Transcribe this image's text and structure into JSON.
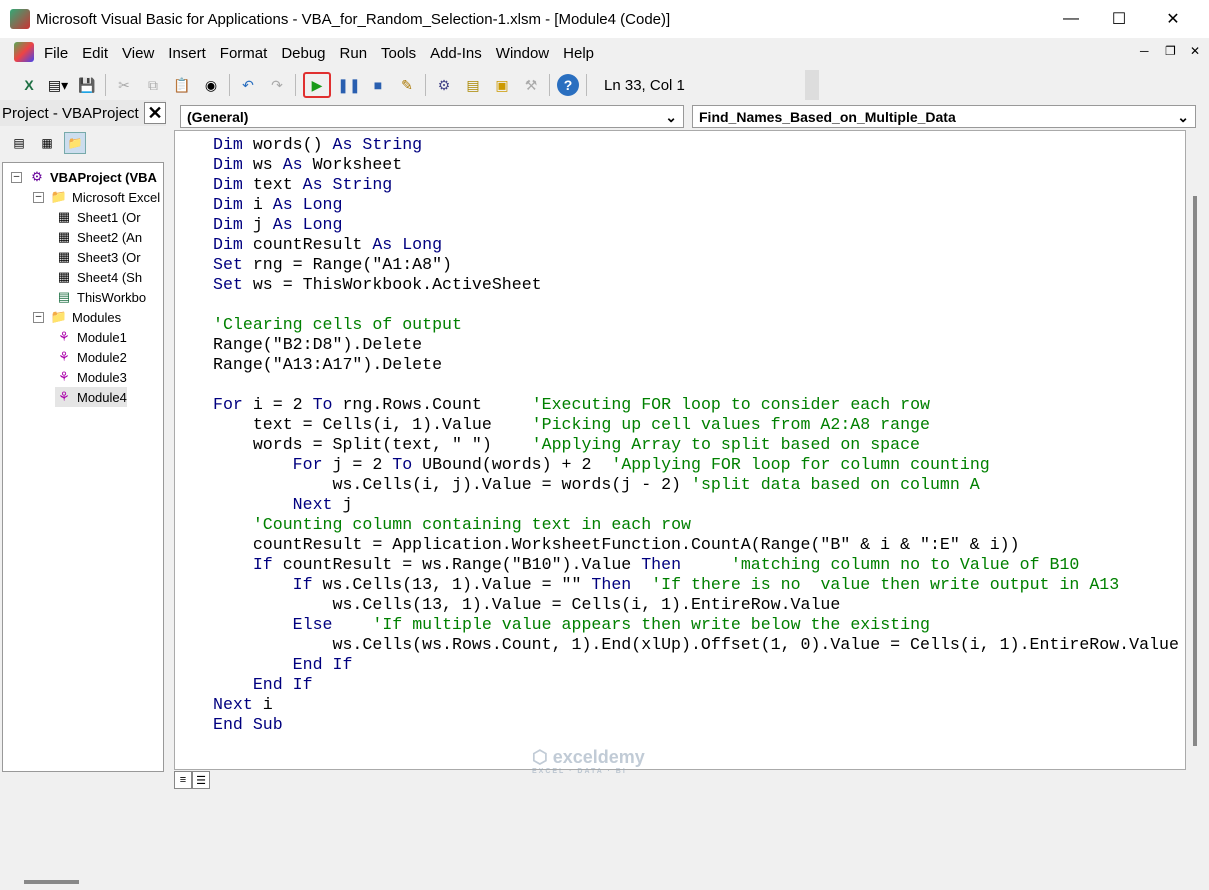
{
  "window": {
    "title": "Microsoft Visual Basic for Applications - VBA_for_Random_Selection-1.xlsm - [Module4 (Code)]"
  },
  "menu": [
    "File",
    "Edit",
    "View",
    "Insert",
    "Format",
    "Debug",
    "Run",
    "Tools",
    "Add-Ins",
    "Window",
    "Help"
  ],
  "toolbar": {
    "status": "Ln 33, Col 1",
    "icons": [
      "excel-icon",
      "insert-userform-icon",
      "save-icon",
      "cut-icon",
      "copy-icon",
      "paste-icon",
      "find-icon",
      "undo-icon",
      "redo-icon",
      "run-icon",
      "break-icon",
      "reset-icon",
      "design-mode-icon",
      "project-explorer-icon",
      "properties-icon",
      "object-browser-icon",
      "toolbox-icon",
      "help-icon"
    ]
  },
  "project": {
    "title": "Project - VBAProject",
    "tree": [
      {
        "label": "VBAProject (VBA",
        "level": 0,
        "type": "project",
        "bold": true
      },
      {
        "label": "Microsoft Excel",
        "level": 1,
        "type": "folder"
      },
      {
        "label": "Sheet1 (Or",
        "level": 2,
        "type": "sheet"
      },
      {
        "label": "Sheet2 (An",
        "level": 2,
        "type": "sheet"
      },
      {
        "label": "Sheet3 (Or",
        "level": 2,
        "type": "sheet"
      },
      {
        "label": "Sheet4 (Sh",
        "level": 2,
        "type": "sheet"
      },
      {
        "label": "ThisWorkbo",
        "level": 2,
        "type": "workbook"
      },
      {
        "label": "Modules",
        "level": 1,
        "type": "folder"
      },
      {
        "label": "Module1",
        "level": 2,
        "type": "module"
      },
      {
        "label": "Module2",
        "level": 2,
        "type": "module"
      },
      {
        "label": "Module3",
        "level": 2,
        "type": "module"
      },
      {
        "label": "Module4",
        "level": 2,
        "type": "module",
        "selected": true
      }
    ]
  },
  "code": {
    "object": "(General)",
    "procedure": "Find_Names_Based_on_Multiple_Data",
    "lines": [
      [
        [
          "k",
          "Dim"
        ],
        [
          "n",
          " words() "
        ],
        [
          "k",
          "As"
        ],
        [
          "n",
          " "
        ],
        [
          "k",
          "String"
        ]
      ],
      [
        [
          "k",
          "Dim"
        ],
        [
          "n",
          " ws "
        ],
        [
          "k",
          "As"
        ],
        [
          "n",
          " Worksheet"
        ]
      ],
      [
        [
          "k",
          "Dim"
        ],
        [
          "n",
          " text "
        ],
        [
          "k",
          "As"
        ],
        [
          "n",
          " "
        ],
        [
          "k",
          "String"
        ]
      ],
      [
        [
          "k",
          "Dim"
        ],
        [
          "n",
          " i "
        ],
        [
          "k",
          "As"
        ],
        [
          "n",
          " "
        ],
        [
          "k",
          "Long"
        ]
      ],
      [
        [
          "k",
          "Dim"
        ],
        [
          "n",
          " j "
        ],
        [
          "k",
          "As"
        ],
        [
          "n",
          " "
        ],
        [
          "k",
          "Long"
        ]
      ],
      [
        [
          "k",
          "Dim"
        ],
        [
          "n",
          " countResult "
        ],
        [
          "k",
          "As"
        ],
        [
          "n",
          " "
        ],
        [
          "k",
          "Long"
        ]
      ],
      [
        [
          "k",
          "Set"
        ],
        [
          "n",
          " rng = Range(\"A1:A8\")"
        ]
      ],
      [
        [
          "k",
          "Set"
        ],
        [
          "n",
          " ws = ThisWorkbook.ActiveSheet"
        ]
      ],
      [
        [
          "n",
          ""
        ]
      ],
      [
        [
          "c",
          "'Clearing cells of output"
        ]
      ],
      [
        [
          "n",
          "Range(\"B2:D8\").Delete"
        ]
      ],
      [
        [
          "n",
          "Range(\"A13:A17\").Delete"
        ]
      ],
      [
        [
          "n",
          ""
        ]
      ],
      [
        [
          "k",
          "For"
        ],
        [
          "n",
          " i = 2 "
        ],
        [
          "k",
          "To"
        ],
        [
          "n",
          " rng.Rows.Count     "
        ],
        [
          "c",
          "'Executing FOR loop to consider each row"
        ]
      ],
      [
        [
          "n",
          "    text = Cells(i, 1).Value    "
        ],
        [
          "c",
          "'Picking up cell values from A2:A8 range"
        ]
      ],
      [
        [
          "n",
          "    words = Split(text, \" \")    "
        ],
        [
          "c",
          "'Applying Array to split based on space"
        ]
      ],
      [
        [
          "n",
          "        "
        ],
        [
          "k",
          "For"
        ],
        [
          "n",
          " j = 2 "
        ],
        [
          "k",
          "To"
        ],
        [
          "n",
          " UBound(words) + 2  "
        ],
        [
          "c",
          "'Applying FOR loop for column counting"
        ]
      ],
      [
        [
          "n",
          "            ws.Cells(i, j).Value = words(j - 2) "
        ],
        [
          "c",
          "'split data based on column A"
        ]
      ],
      [
        [
          "n",
          "        "
        ],
        [
          "k",
          "Next"
        ],
        [
          "n",
          " j"
        ]
      ],
      [
        [
          "n",
          "    "
        ],
        [
          "c",
          "'Counting column containing text in each row"
        ]
      ],
      [
        [
          "n",
          "    countResult = Application.WorksheetFunction.CountA(Range(\"B\" & i & \":E\" & i))"
        ]
      ],
      [
        [
          "n",
          "    "
        ],
        [
          "k",
          "If"
        ],
        [
          "n",
          " countResult = ws.Range(\"B10\").Value "
        ],
        [
          "k",
          "Then"
        ],
        [
          "n",
          "     "
        ],
        [
          "c",
          "'matching column no to Value of B10"
        ]
      ],
      [
        [
          "n",
          "        "
        ],
        [
          "k",
          "If"
        ],
        [
          "n",
          " ws.Cells(13, 1).Value = \"\" "
        ],
        [
          "k",
          "Then"
        ],
        [
          "n",
          "  "
        ],
        [
          "c",
          "'If there is no  value then write output in A13"
        ]
      ],
      [
        [
          "n",
          "            ws.Cells(13, 1).Value = Cells(i, 1).EntireRow.Value"
        ]
      ],
      [
        [
          "n",
          "        "
        ],
        [
          "k",
          "Else"
        ],
        [
          "n",
          "    "
        ],
        [
          "c",
          "'If multiple value appears then write below the existing"
        ]
      ],
      [
        [
          "n",
          "            ws.Cells(ws.Rows.Count, 1).End(xlUp).Offset(1, 0).Value = Cells(i, 1).EntireRow.Value"
        ]
      ],
      [
        [
          "n",
          "        "
        ],
        [
          "k",
          "End If"
        ]
      ],
      [
        [
          "n",
          "    "
        ],
        [
          "k",
          "End If"
        ]
      ],
      [
        [
          "k",
          "Next"
        ],
        [
          "n",
          " i"
        ]
      ],
      [
        [
          "k",
          "End Sub"
        ]
      ]
    ]
  },
  "watermark": {
    "name": "exceldemy",
    "tagline": "EXCEL · DATA · BI"
  },
  "colors": {
    "keyword": "#00007f",
    "comment": "#008000",
    "run_highlight": "#e03030"
  }
}
